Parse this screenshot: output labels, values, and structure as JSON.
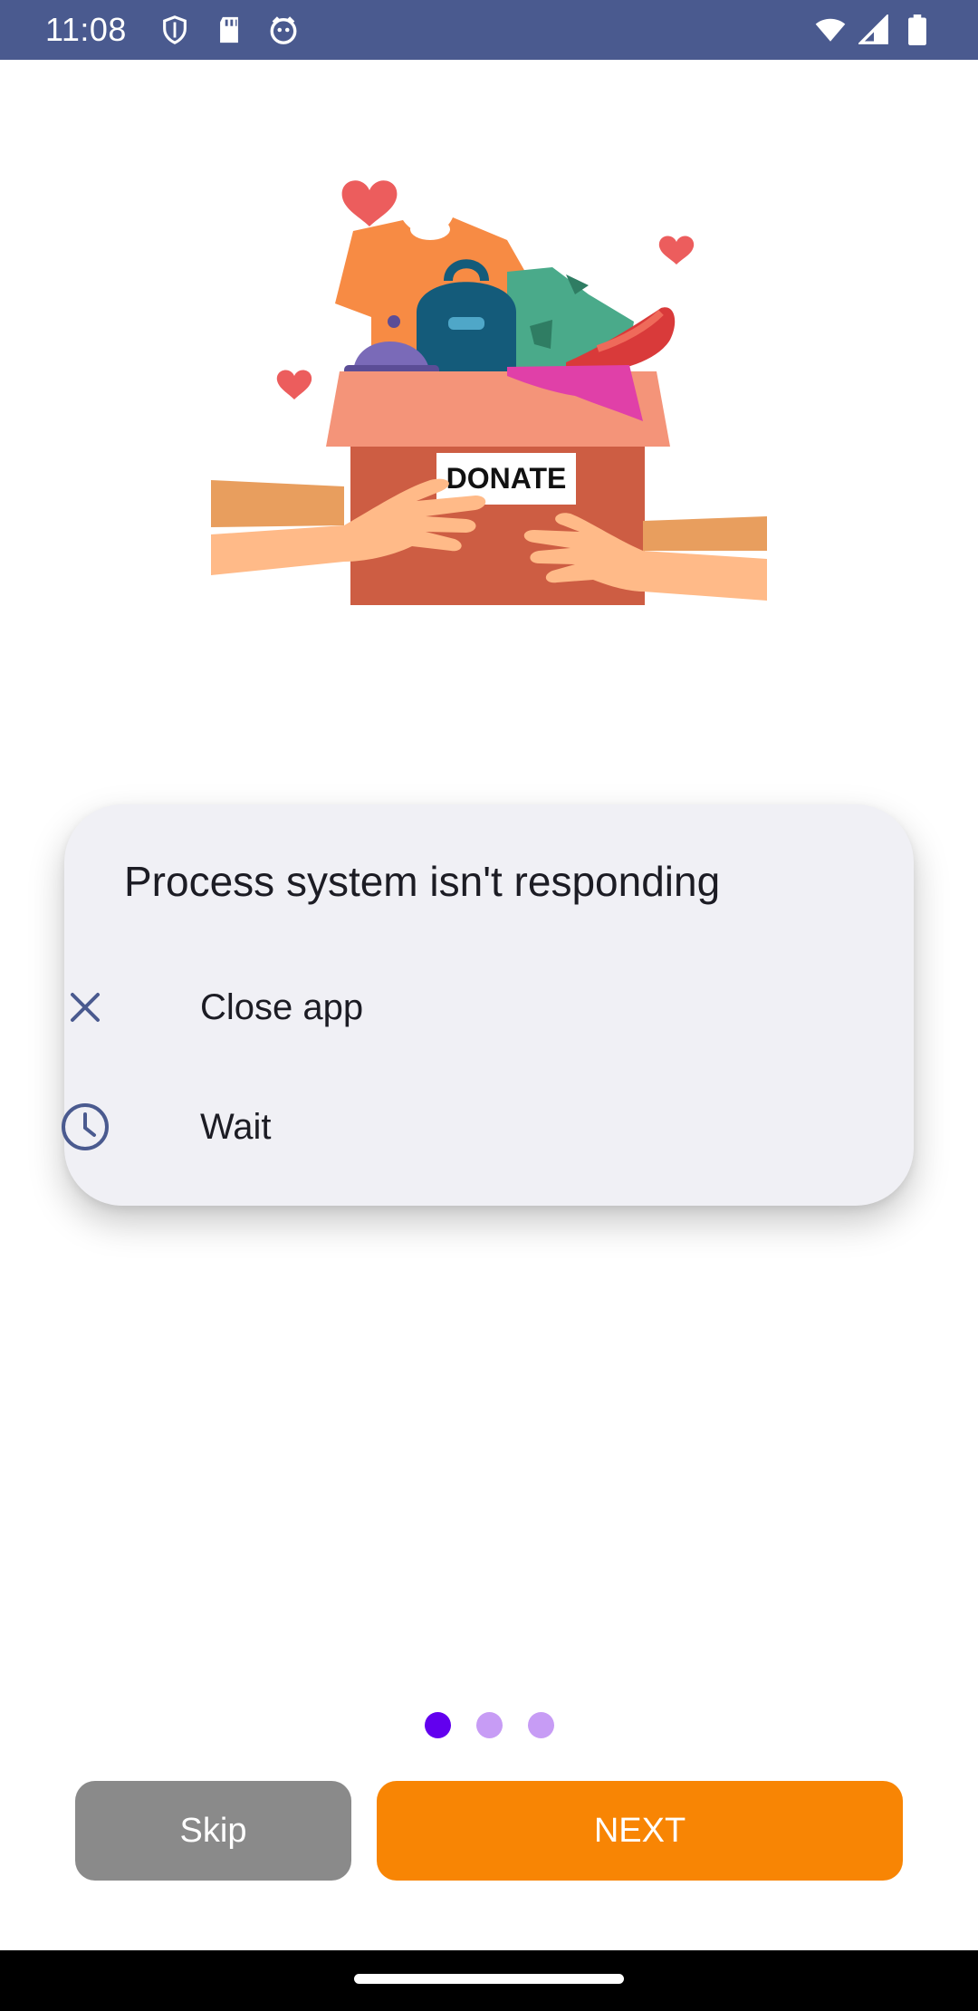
{
  "status_bar": {
    "time": "11:08",
    "left_icons": [
      "shield-icon",
      "sd-card-icon",
      "cat-face-icon"
    ],
    "right_icons": [
      "wifi-icon",
      "signal-icon",
      "battery-icon"
    ],
    "background": "#4a5a8f"
  },
  "illustration": {
    "box_label": "DONATE"
  },
  "dialog": {
    "title": "Process system isn't responding",
    "options": [
      {
        "label": "Close app",
        "icon": "close-icon"
      },
      {
        "label": "Wait",
        "icon": "clock-icon"
      }
    ],
    "icon_color": "#4a5a8f",
    "background": "#f0f0f5"
  },
  "pager": {
    "total": 3,
    "active_index": 0,
    "active_color": "#6200ee",
    "inactive_color": "#c79cf5"
  },
  "buttons": {
    "skip_label": "Skip",
    "next_label": "NEXT",
    "skip_color": "#8a8a8a",
    "next_color": "#f88504"
  }
}
